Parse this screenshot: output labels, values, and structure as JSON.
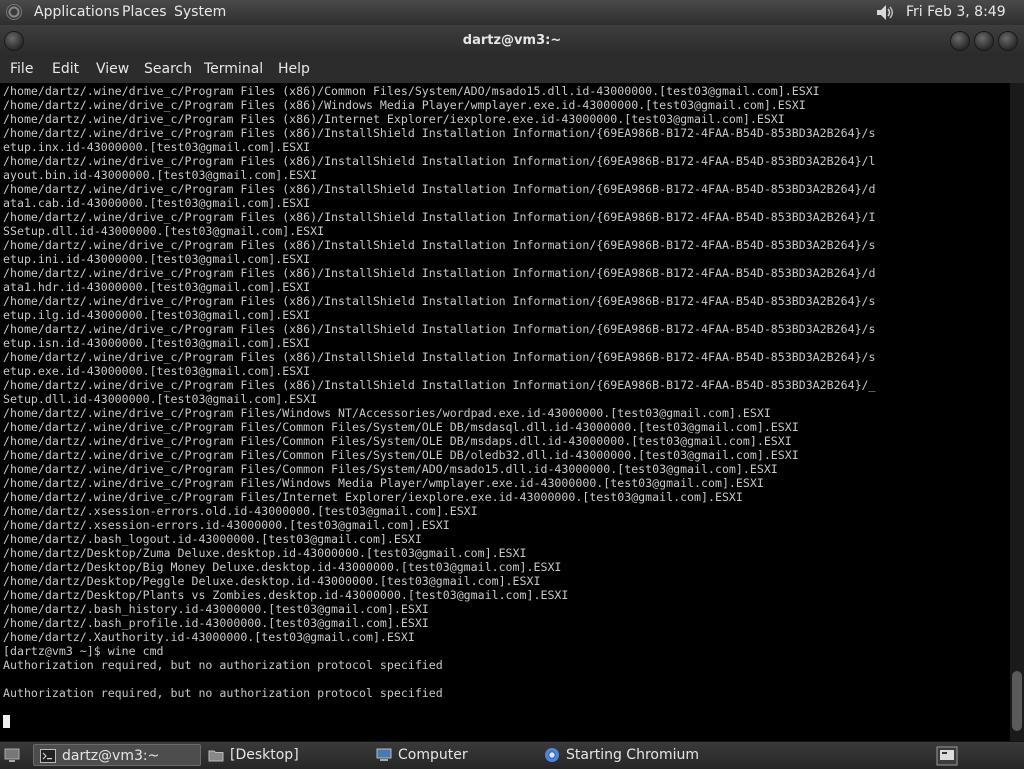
{
  "top_panel": {
    "menus": [
      "Applications",
      "Places",
      "System"
    ],
    "clock": "Fri Feb  3,  8:49 PM"
  },
  "window": {
    "title": "dartz@vm3:~",
    "menubar": [
      "File",
      "Edit",
      "View",
      "Search",
      "Terminal",
      "Help"
    ]
  },
  "terminal": {
    "lines": [
      "/home/dartz/.wine/drive_c/Program Files (x86)/Common Files/System/ADO/msado15.dll.id-43000000.[test03@gmail.com].ESXI",
      "/home/dartz/.wine/drive_c/Program Files (x86)/Windows Media Player/wmplayer.exe.id-43000000.[test03@gmail.com].ESXI",
      "/home/dartz/.wine/drive_c/Program Files (x86)/Internet Explorer/iexplore.exe.id-43000000.[test03@gmail.com].ESXI",
      "/home/dartz/.wine/drive_c/Program Files (x86)/InstallShield Installation Information/{69EA986B-B172-4FAA-B54D-853BD3A2B264}/s",
      "etup.inx.id-43000000.[test03@gmail.com].ESXI",
      "/home/dartz/.wine/drive_c/Program Files (x86)/InstallShield Installation Information/{69EA986B-B172-4FAA-B54D-853BD3A2B264}/l",
      "ayout.bin.id-43000000.[test03@gmail.com].ESXI",
      "/home/dartz/.wine/drive_c/Program Files (x86)/InstallShield Installation Information/{69EA986B-B172-4FAA-B54D-853BD3A2B264}/d",
      "ata1.cab.id-43000000.[test03@gmail.com].ESXI",
      "/home/dartz/.wine/drive_c/Program Files (x86)/InstallShield Installation Information/{69EA986B-B172-4FAA-B54D-853BD3A2B264}/I",
      "SSetup.dll.id-43000000.[test03@gmail.com].ESXI",
      "/home/dartz/.wine/drive_c/Program Files (x86)/InstallShield Installation Information/{69EA986B-B172-4FAA-B54D-853BD3A2B264}/s",
      "etup.ini.id-43000000.[test03@gmail.com].ESXI",
      "/home/dartz/.wine/drive_c/Program Files (x86)/InstallShield Installation Information/{69EA986B-B172-4FAA-B54D-853BD3A2B264}/d",
      "ata1.hdr.id-43000000.[test03@gmail.com].ESXI",
      "/home/dartz/.wine/drive_c/Program Files (x86)/InstallShield Installation Information/{69EA986B-B172-4FAA-B54D-853BD3A2B264}/s",
      "etup.ilg.id-43000000.[test03@gmail.com].ESXI",
      "/home/dartz/.wine/drive_c/Program Files (x86)/InstallShield Installation Information/{69EA986B-B172-4FAA-B54D-853BD3A2B264}/s",
      "etup.isn.id-43000000.[test03@gmail.com].ESXI",
      "/home/dartz/.wine/drive_c/Program Files (x86)/InstallShield Installation Information/{69EA986B-B172-4FAA-B54D-853BD3A2B264}/s",
      "etup.exe.id-43000000.[test03@gmail.com].ESXI",
      "/home/dartz/.wine/drive_c/Program Files (x86)/InstallShield Installation Information/{69EA986B-B172-4FAA-B54D-853BD3A2B264}/_",
      "Setup.dll.id-43000000.[test03@gmail.com].ESXI",
      "/home/dartz/.wine/drive_c/Program Files/Windows NT/Accessories/wordpad.exe.id-43000000.[test03@gmail.com].ESXI",
      "/home/dartz/.wine/drive_c/Program Files/Common Files/System/OLE DB/msdasql.dll.id-43000000.[test03@gmail.com].ESXI",
      "/home/dartz/.wine/drive_c/Program Files/Common Files/System/OLE DB/msdaps.dll.id-43000000.[test03@gmail.com].ESXI",
      "/home/dartz/.wine/drive_c/Program Files/Common Files/System/OLE DB/oledb32.dll.id-43000000.[test03@gmail.com].ESXI",
      "/home/dartz/.wine/drive_c/Program Files/Common Files/System/ADO/msado15.dll.id-43000000.[test03@gmail.com].ESXI",
      "/home/dartz/.wine/drive_c/Program Files/Windows Media Player/wmplayer.exe.id-43000000.[test03@gmail.com].ESXI",
      "/home/dartz/.wine/drive_c/Program Files/Internet Explorer/iexplore.exe.id-43000000.[test03@gmail.com].ESXI",
      "/home/dartz/.xsession-errors.old.id-43000000.[test03@gmail.com].ESXI",
      "/home/dartz/.xsession-errors.id-43000000.[test03@gmail.com].ESXI",
      "/home/dartz/.bash_logout.id-43000000.[test03@gmail.com].ESXI",
      "/home/dartz/Desktop/Zuma Deluxe.desktop.id-43000000.[test03@gmail.com].ESXI",
      "/home/dartz/Desktop/Big Money Deluxe.desktop.id-43000000.[test03@gmail.com].ESXI",
      "/home/dartz/Desktop/Peggle Deluxe.desktop.id-43000000.[test03@gmail.com].ESXI",
      "/home/dartz/Desktop/Plants vs Zombies.desktop.id-43000000.[test03@gmail.com].ESXI",
      "/home/dartz/.bash_history.id-43000000.[test03@gmail.com].ESXI",
      "/home/dartz/.bash_profile.id-43000000.[test03@gmail.com].ESXI",
      "/home/dartz/.Xauthority.id-43000000.[test03@gmail.com].ESXI",
      "[dartz@vm3 ~]$ wine cmd",
      "Authorization required, but no authorization protocol specified",
      "",
      "Authorization required, but no authorization protocol specified"
    ]
  },
  "taskbar": {
    "items": [
      "dartz@vm3:~",
      "[Desktop]",
      "Computer",
      "Starting Chromium"
    ]
  }
}
